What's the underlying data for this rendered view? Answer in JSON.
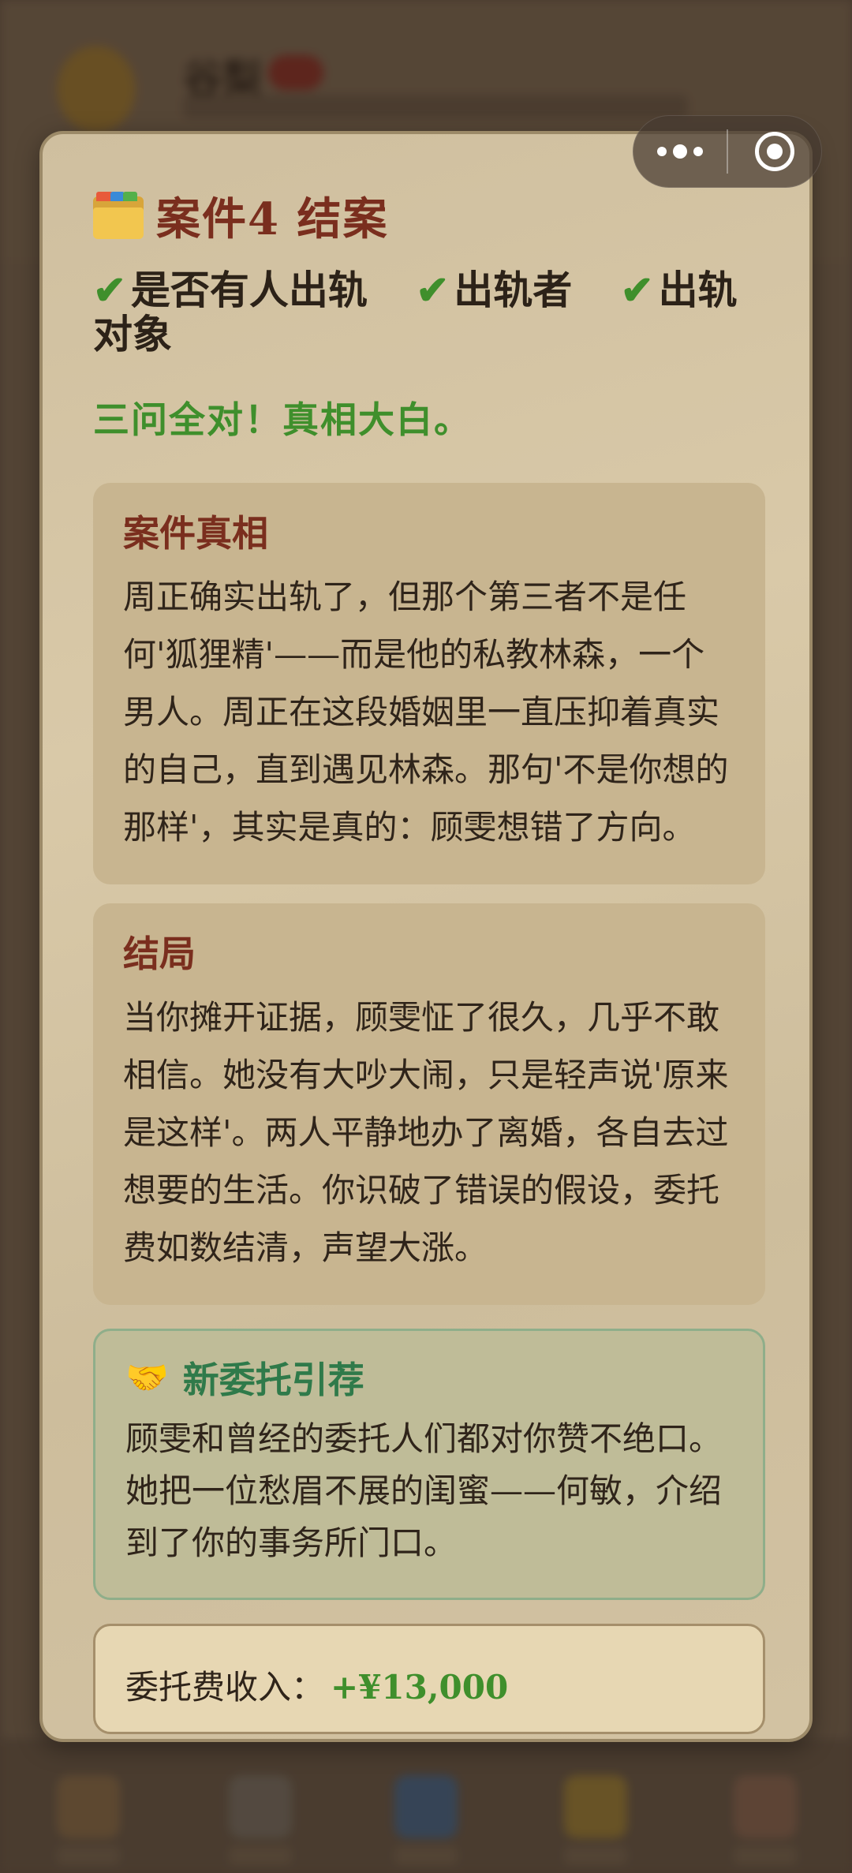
{
  "background": {
    "user_name": "谷梨"
  },
  "capsule": {
    "more_icon": "more-dots-icon",
    "close_icon": "close-ring-icon"
  },
  "modal": {
    "title": "案件4 结案",
    "title_icon": "folder-icon",
    "checks": [
      {
        "icon": "✔",
        "label": "是否有人出轨"
      },
      {
        "icon": "✔",
        "label": "出轨者"
      },
      {
        "icon": "✔",
        "label": "出轨对象"
      }
    ],
    "verdict": "三问全对！真相大白。",
    "truth": {
      "heading": "案件真相",
      "body": "周正确实出轨了，但那个第三者不是任何'狐狸精'——而是他的私教林森，一个男人。周正在这段婚姻里一直压抑着真实的自己，直到遇见林森。那句'不是你想的那样'，其实是真的：顾雯想错了方向。"
    },
    "ending": {
      "heading": "结局",
      "body": "当你摊开证据，顾雯怔了很久，几乎不敢相信。她没有大吵大闹，只是轻声说'原来是这样'。两人平静地办了离婚，各自去过想要的生活。你识破了错误的假设，委托费如数结清，声望大涨。"
    },
    "recommend": {
      "icon": "🤝",
      "heading": "新委托引荐",
      "body": "顾雯和曾经的委托人们都对你赞不绝口。她把一位愁眉不展的闺蜜——何敏，介绍到了你的事务所门口。"
    },
    "fee": {
      "label": "委托费收入：",
      "amount": "+¥13,000"
    }
  },
  "colors": {
    "accent_red": "#7a2e1e",
    "success_green": "#3f8f2c",
    "recommend_green": "#2f7a4a"
  }
}
